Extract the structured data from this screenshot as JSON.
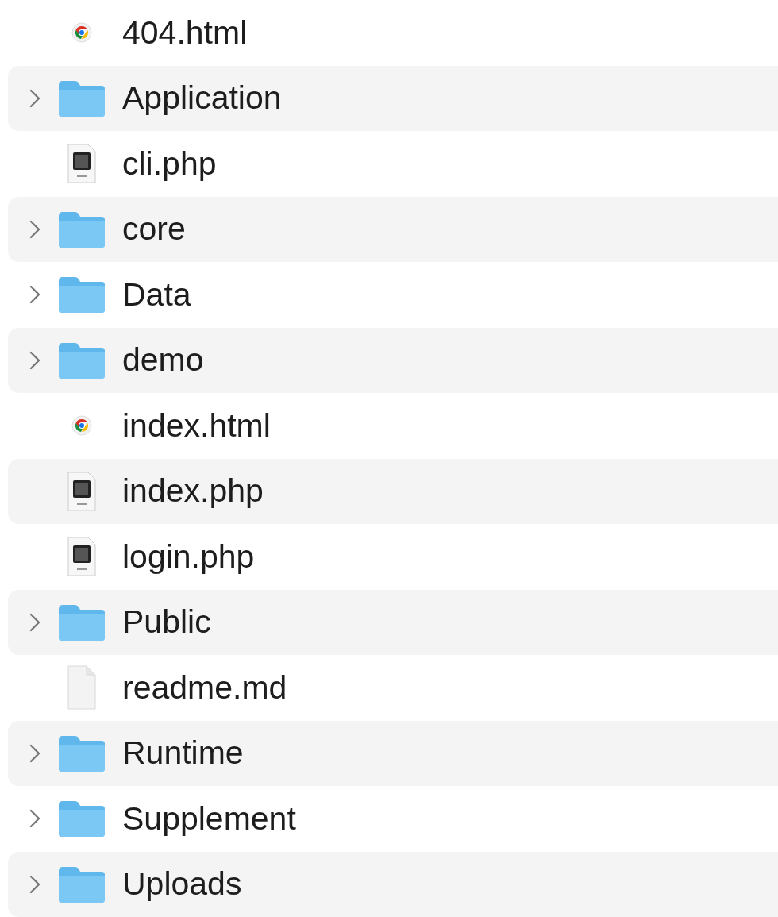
{
  "files": [
    {
      "name": "404.html",
      "kind": "browser-file"
    },
    {
      "name": "Application",
      "kind": "folder"
    },
    {
      "name": "cli.php",
      "kind": "php-file"
    },
    {
      "name": "core",
      "kind": "folder"
    },
    {
      "name": "Data",
      "kind": "folder"
    },
    {
      "name": "demo",
      "kind": "folder"
    },
    {
      "name": "index.html",
      "kind": "browser-file"
    },
    {
      "name": "index.php",
      "kind": "php-file"
    },
    {
      "name": "login.php",
      "kind": "php-file"
    },
    {
      "name": "Public",
      "kind": "folder"
    },
    {
      "name": "readme.md",
      "kind": "text-file"
    },
    {
      "name": "Runtime",
      "kind": "folder"
    },
    {
      "name": "Supplement",
      "kind": "folder"
    },
    {
      "name": "Uploads",
      "kind": "folder"
    }
  ]
}
